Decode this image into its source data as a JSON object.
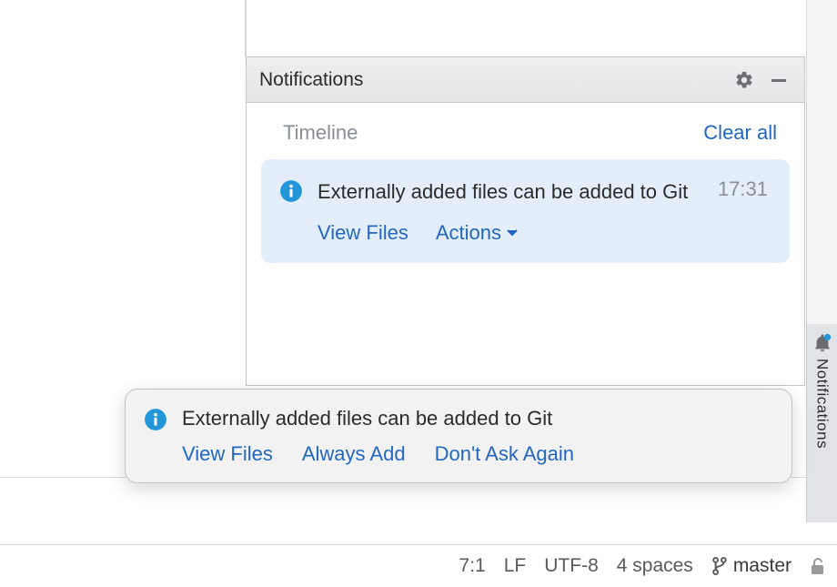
{
  "panel": {
    "title": "Notifications",
    "timeline_label": "Timeline",
    "clear_all": "Clear all"
  },
  "notification": {
    "message": "Externally added files can be added to Git",
    "time": "17:31",
    "view_files": "View Files",
    "actions_label": "Actions"
  },
  "balloon": {
    "message": "Externally added files can be added to Git",
    "view_files": "View Files",
    "always_add": "Always Add",
    "dont_ask": "Don't Ask Again"
  },
  "sidebar": {
    "notifications_label": "Notifications"
  },
  "statusbar": {
    "position": "7:1",
    "line_sep": "LF",
    "encoding": "UTF-8",
    "indent": "4 spaces",
    "branch": "master"
  },
  "colors": {
    "link": "#2368c0",
    "info": "#2395d9"
  }
}
